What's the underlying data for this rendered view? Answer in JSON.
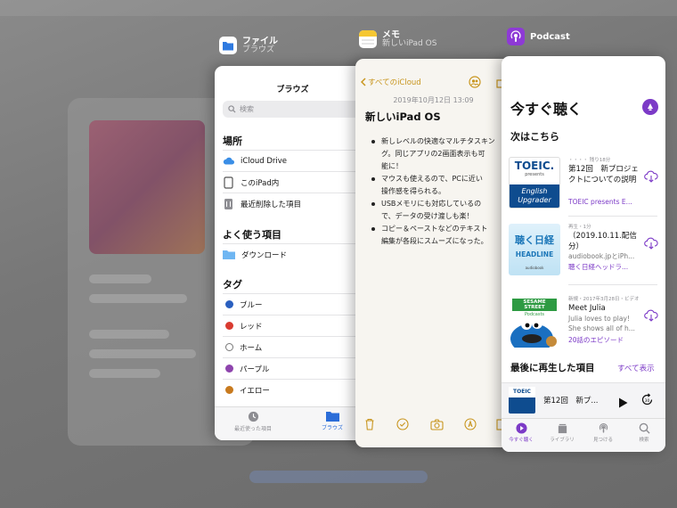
{
  "files": {
    "app_name": "ファイル",
    "app_sub": "ブラウズ",
    "title": "ブラウズ",
    "search_placeholder": "検索",
    "section_places": "場所",
    "places": [
      "iCloud Drive",
      "このiPad内",
      "最近削除した項目"
    ],
    "section_favorites": "よく使う項目",
    "favorites": [
      "ダウンロード"
    ],
    "section_tags": "タグ",
    "tags": [
      {
        "label": "ブルー",
        "color": "#2a5fbf"
      },
      {
        "label": "レッド",
        "color": "#d93b30"
      },
      {
        "label": "ホーム",
        "color": "#ffffff"
      },
      {
        "label": "パープル",
        "color": "#8e44ad"
      },
      {
        "label": "イエロー",
        "color": "#c87a1e"
      }
    ],
    "tab_recent": "最近使った項目",
    "tab_browse": "ブラウズ"
  },
  "notes": {
    "app_name": "メモ",
    "app_sub": "新しいiPad OS",
    "back_label": "すべてのiCloud",
    "date": "2019年10月12日 13:09",
    "title": "新しいiPad OS",
    "bullets": [
      "新しレベルの快適なマルチタスキン\nグ。同じアプリの2画面表示も可\n能に！",
      "マウスも使えるので、PCに近い\n操作感を得られる。",
      "USBメモリにも対応しているの\nで、データの受け渡しも楽！",
      "コピー＆ペーストなどのテキスト\n編集が各段にスムーズになった。"
    ]
  },
  "podcast": {
    "app_name": "Podcast",
    "title": "今すぐ聴く",
    "next_header": "次はこちら",
    "episodes": [
      {
        "meta": "・・・・ 残り18分",
        "title": "第12回　新プロジェクトについての説明",
        "desc": "",
        "link": "TOEIC presents E...",
        "art_lines": [
          "TOEIC.",
          "presents",
          "English",
          "Upgrader"
        ]
      },
      {
        "meta": "再生・1分",
        "title": "（2019.10.11.配信分）",
        "desc": "audiobook.jpとiPh...",
        "link": "聴く日経ヘッドラ...",
        "art_lines": [
          "聴く日経",
          "HEADLINE",
          "audiobook"
        ]
      },
      {
        "meta": "新規・2017年3月28日・ビデオ",
        "title": "Meet Julia",
        "desc": "Julia loves to play! She shows all of h...",
        "link": "20話のエピソード",
        "art_lines": [
          "SESAME STREET",
          "Podcasts"
        ]
      }
    ],
    "recent_header": "最後に再生した項目",
    "show_all": "すべて表示",
    "mini_player_title": "第12回　新プ...",
    "tabs": [
      "今すぐ聴く",
      "ライブラリ",
      "見つける",
      "検索"
    ]
  }
}
